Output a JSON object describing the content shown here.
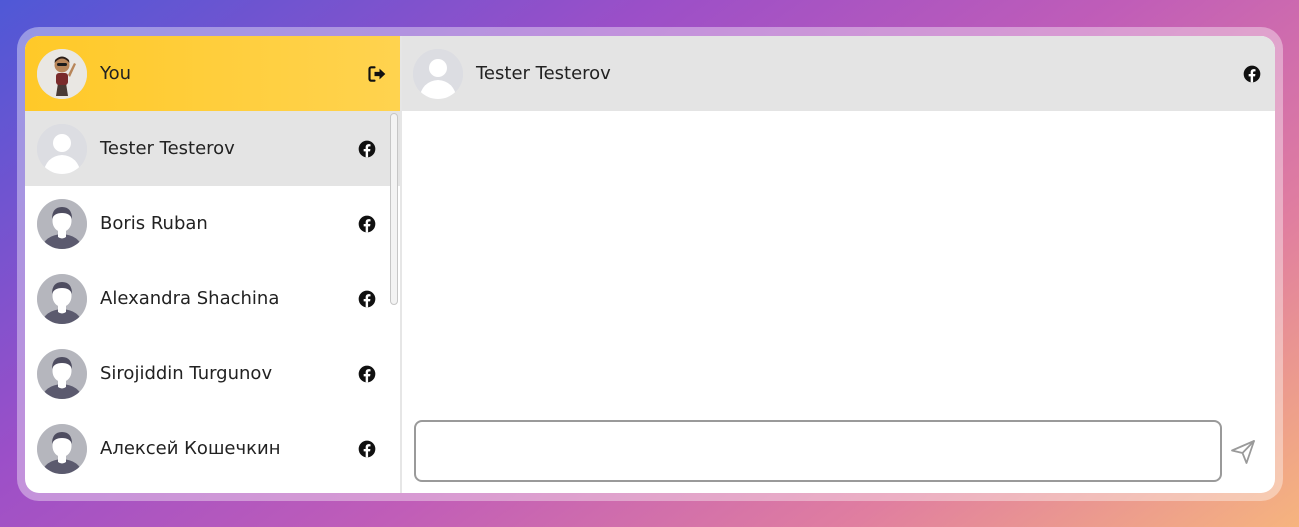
{
  "me": {
    "name": "You",
    "avatar_icon": "avatar-cartoon-icon",
    "logout_icon": "logout-icon"
  },
  "contacts": [
    {
      "name": "Tester Testerov",
      "avatar_icon": "default-avatar-icon",
      "source_icon": "facebook-icon",
      "active": true
    },
    {
      "name": "Boris Ruban",
      "avatar_icon": "user-avatar-icon",
      "source_icon": "facebook-icon",
      "active": false
    },
    {
      "name": "Alexandra Shachina",
      "avatar_icon": "user-avatar-icon",
      "source_icon": "facebook-icon",
      "active": false
    },
    {
      "name": "Sirojiddin Turgunov",
      "avatar_icon": "user-avatar-icon",
      "source_icon": "facebook-icon",
      "active": false
    },
    {
      "name": "Алексей Кошечкин",
      "avatar_icon": "user-avatar-icon",
      "source_icon": "facebook-icon",
      "active": false
    }
  ],
  "chat": {
    "title": "Tester Testerov",
    "source_icon": "facebook-icon",
    "message_input": {
      "value": "",
      "placeholder": ""
    },
    "send_icon": "send-icon"
  },
  "colors": {
    "header_yellow": "#ffc928",
    "active_gray": "#e4e4e4",
    "background_gradient": [
      "#4f58d6",
      "#c05db8",
      "#f6b47e"
    ]
  }
}
